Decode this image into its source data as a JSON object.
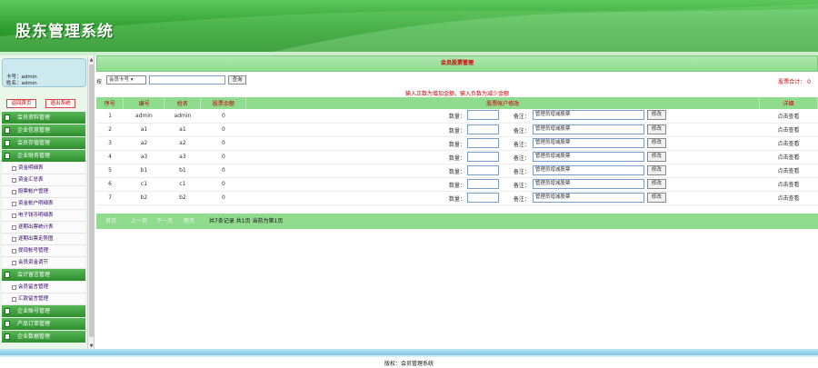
{
  "app": {
    "title": "股东管理系统"
  },
  "user": {
    "account_label": "卡号：admin",
    "name_label": "姓名：admin"
  },
  "quick": {
    "home": "返回首页",
    "logout": "退出系统"
  },
  "menu": [
    {
      "label": "会员资料管理",
      "items": []
    },
    {
      "label": "企业信息管理",
      "items": []
    },
    {
      "label": "会员存值管理",
      "items": []
    },
    {
      "label": "企业财务管理",
      "items": [
        "资金明细表",
        "资金汇总表",
        "股票帐户管理",
        "资金帐户明细表",
        "电子钱币明细表",
        "逐期出票统计表",
        "逐期出票走势图",
        "提现帐号管理",
        "会员资金调节"
      ]
    },
    {
      "label": "会计留言管理",
      "items": [
        "会员留言管理",
        "汇款留言管理"
      ]
    },
    {
      "label": "企业账号管理",
      "items": []
    },
    {
      "label": "产品订单管理",
      "items": []
    },
    {
      "label": "企业数据管理",
      "items": []
    }
  ],
  "main": {
    "title": "会员股票管理",
    "search_prefix": "按",
    "search_select": "会员卡号",
    "search_button": "查询",
    "total_label": "股票合计： 0",
    "tip": "输入正数为增加金额，输入负数为减少金额",
    "headers": [
      "序号",
      "编号",
      "姓名",
      "股票余额",
      "股票帐户修改",
      "详细"
    ],
    "row_ops": {
      "amount_label": "数量：",
      "note_label": "备注：",
      "note_value": "管理员增减股票",
      "modify": "修改",
      "detail": "点击查看"
    },
    "rows": [
      {
        "seq": "1",
        "code": "admin",
        "name": "admin",
        "balance": "0"
      },
      {
        "seq": "2",
        "code": "a1",
        "name": "a1",
        "balance": "0"
      },
      {
        "seq": "3",
        "code": "a2",
        "name": "a2",
        "balance": "0"
      },
      {
        "seq": "4",
        "code": "a3",
        "name": "a3",
        "balance": "0"
      },
      {
        "seq": "5",
        "code": "b1",
        "name": "b1",
        "balance": "0"
      },
      {
        "seq": "6",
        "code": "c1",
        "name": "c1",
        "balance": "0"
      },
      {
        "seq": "7",
        "code": "b2",
        "name": "b2",
        "balance": "0"
      }
    ],
    "pager": {
      "first": "首页",
      "prev": "上一页",
      "next": "下一页",
      "last": "尾页",
      "info": "共7条记录 共1页 当前为第1页"
    }
  },
  "footer": {
    "copyright": "版权：会员管理系统"
  }
}
